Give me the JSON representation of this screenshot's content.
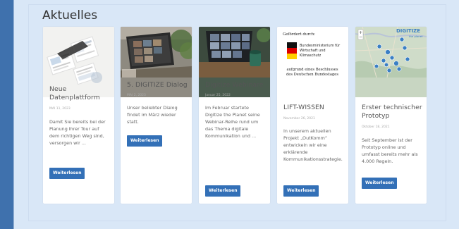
{
  "section": {
    "title": "Aktuelles"
  },
  "colors": {
    "accent": "#3370b7",
    "panel": "#d9e7f7",
    "stripe": "#3f71ad"
  },
  "cards": [
    {
      "title": "Neue Datenplattform",
      "date": "MAI 11, 2023",
      "excerpt": "Damit Sie bereits bei der Planung Ihrer Tour auf dem richtigen Weg sind, versorgen wir ...",
      "button": "Weiterlesen"
    },
    {
      "title": "5. DIGITIZE Dialog",
      "date": "MAI 2, 2023",
      "excerpt": "Unser beliebter Dialog findet im März wieder statt.",
      "button": "Weiterlesen"
    },
    {
      "title": "Digitize Webinare",
      "date": "Januar 25, 2022",
      "excerpt": "Im Februar startete Digitize the Planet seine Webinar-Reihe rund um das Thema digitale Kommunikation und ...",
      "button": "Weiterlesen"
    },
    {
      "title": "LIFT-WISSEN",
      "date": "November 26, 2021",
      "excerpt": "In unserem aktuellen Projekt „OutKomm“ entwickeln wir eine erklärende Kommunikationsstrategie.",
      "button": "Weiterlesen",
      "image_text": {
        "funded_by": "Gefördert durch:",
        "ministry": "Bundesministerium für Wirtschaft und Klimaschutz",
        "resolution": "aufgrund eines Beschlusses des Deutschen Bundestages"
      }
    },
    {
      "title": "Erster technischer Prototyp",
      "date": "Oktober 18, 2021",
      "excerpt": "Seit September ist der Prototyp online und umfasst bereits mehr als 4.000 Regeln.",
      "button": "Weiterlesen",
      "image_text": {
        "logo": "DIGITIZE",
        "logo_sub": "the planet"
      }
    }
  ]
}
